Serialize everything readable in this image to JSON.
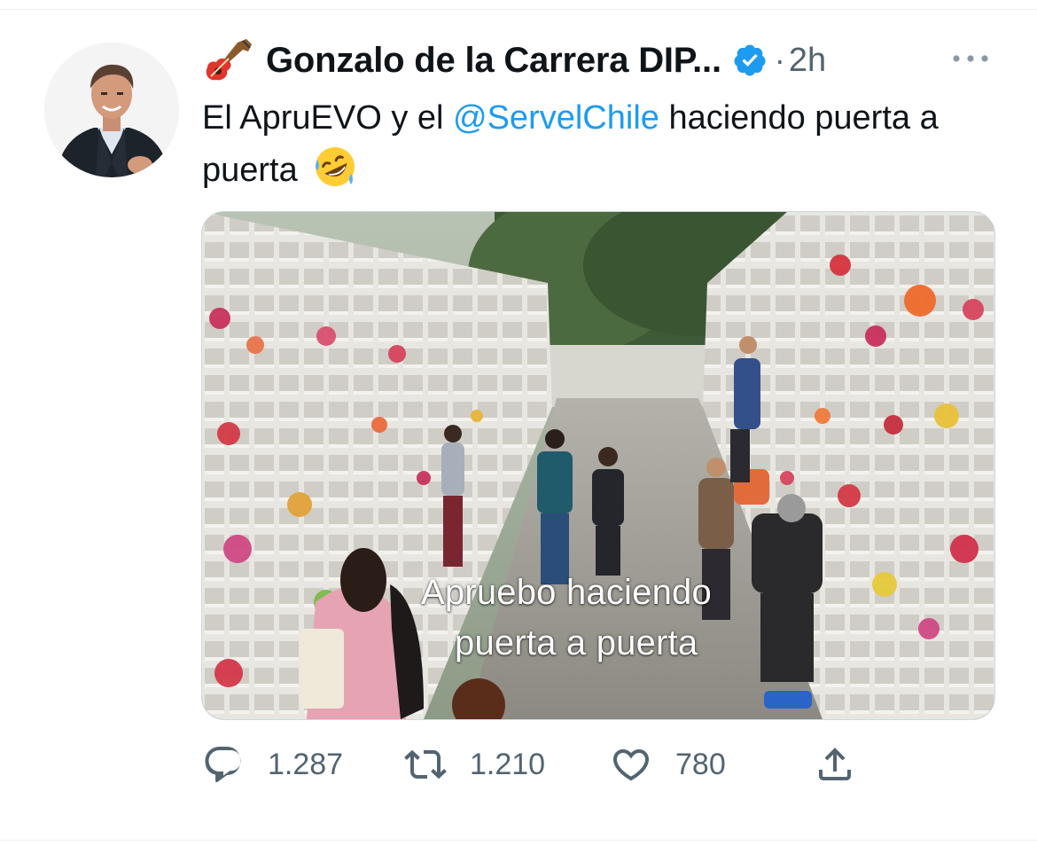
{
  "tweet": {
    "author_name": "Gonzalo de la Carrera DIP...",
    "separator": "·",
    "timestamp": "2h",
    "text_before": "El ApruEVO y el ",
    "mention": "@ServelChile",
    "text_after": " haciendo puerta a puerta",
    "icons": {
      "name_prefix": "guitar-icon",
      "verified": "verified-badge-icon",
      "emoji": "rolling-on-floor-laughing-emoji",
      "more": "more-options-icon"
    },
    "colors": {
      "mention": "#1d9bf0",
      "verified": "#1d9bf0",
      "secondary_text": "#536471"
    }
  },
  "media": {
    "caption_line1": "Apruebo haciendo",
    "caption_line2": "puerta a puerta"
  },
  "actions": {
    "reply": {
      "icon": "reply-icon",
      "count": "1.287"
    },
    "retweet": {
      "icon": "retweet-icon",
      "count": "1.210"
    },
    "like": {
      "icon": "heart-icon",
      "count": "780"
    },
    "share": {
      "icon": "share-icon"
    }
  }
}
